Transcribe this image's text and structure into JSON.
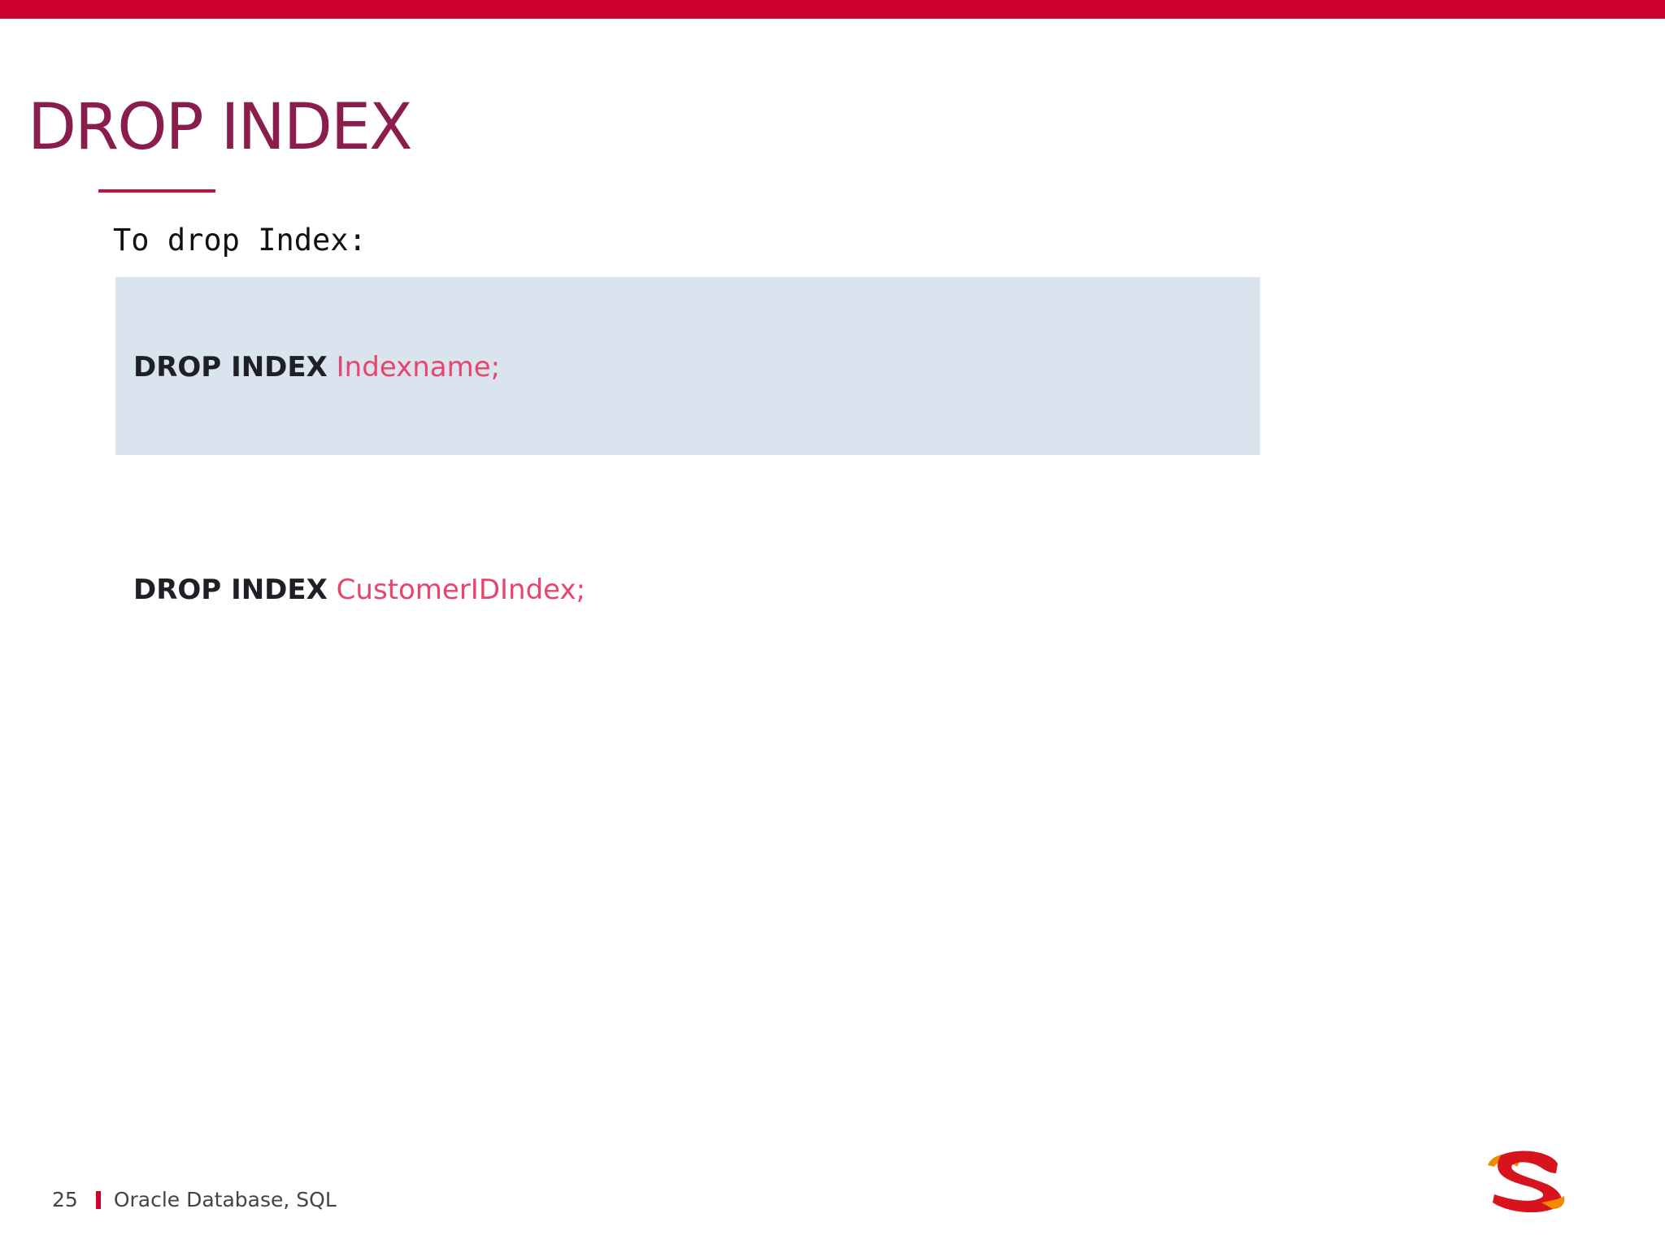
{
  "slide": {
    "title": "DROP INDEX",
    "intro": "To drop Index:",
    "syntax": {
      "keyword": "DROP INDEX",
      "argument": "Indexname;"
    },
    "example": {
      "keyword": "DROP INDEX",
      "argument": "CustomerIDIndex;"
    }
  },
  "footer": {
    "page_number": "25",
    "course": "Oracle Database, SQL"
  },
  "colors": {
    "brand_red": "#cc002b",
    "title_color": "#8a1d4c",
    "code_box_bg": "#d9e4ee",
    "argument_color": "#e8456e"
  },
  "icons": {
    "logo": "brand-logo-icon"
  }
}
